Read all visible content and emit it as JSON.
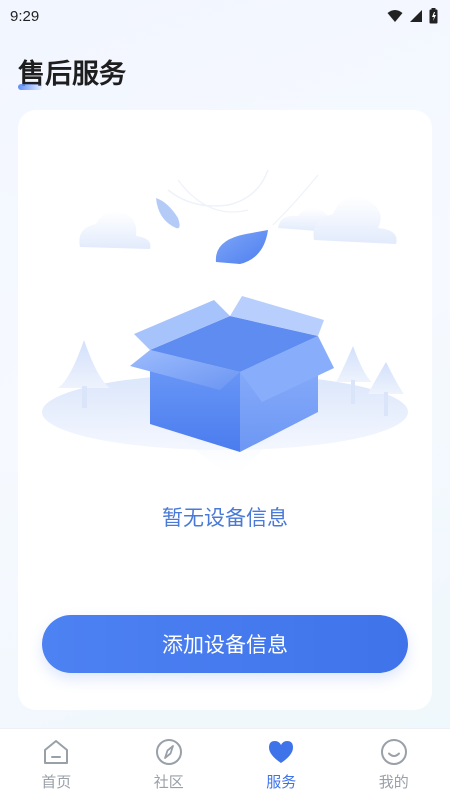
{
  "status": {
    "time": "9:29",
    "icons": [
      "wifi-icon",
      "signal-icon",
      "battery-icon"
    ]
  },
  "page": {
    "title": "售后服务"
  },
  "empty_state": {
    "message": "暂无设备信息",
    "illustration": "empty-box-icon"
  },
  "actions": {
    "add_device_label": "添加设备信息"
  },
  "tabs": [
    {
      "label": "首页",
      "icon": "home-icon",
      "active": false
    },
    {
      "label": "社区",
      "icon": "compass-icon",
      "active": false
    },
    {
      "label": "服务",
      "icon": "heart-icon",
      "active": true
    },
    {
      "label": "我的",
      "icon": "smile-icon",
      "active": false
    }
  ],
  "colors": {
    "accent": "#3f73ea",
    "tab_inactive": "#9aa0a8",
    "empty_text": "#4a7ad8"
  }
}
